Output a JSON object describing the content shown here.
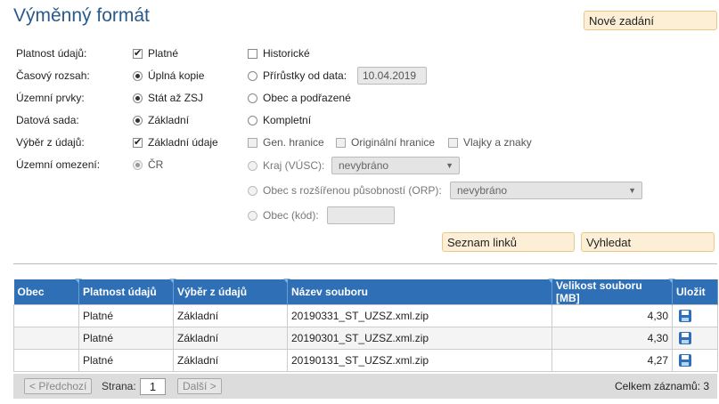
{
  "title": "Výměnný formát",
  "buttons": {
    "new": "Nové zadání",
    "links": "Seznam linků",
    "search": "Vyhledat"
  },
  "form": {
    "validity": {
      "label": "Platnost údajů:",
      "opt1": "Platné",
      "opt2": "Historické"
    },
    "time_range": {
      "label": "Časový rozsah:",
      "opt1": "Úplná kopie",
      "opt2": "Přírůstky od data:",
      "date": "10.04.2019"
    },
    "territorial": {
      "label": "Územní prvky:",
      "opt1": "Stát až ZSJ",
      "opt2": "Obec a podřazené"
    },
    "dataset": {
      "label": "Datová sada:",
      "opt1": "Základní",
      "opt2": "Kompletní"
    },
    "selection": {
      "label": "Výběr z údajů:",
      "opt1": "Základní údaje",
      "opt2": "Gen. hranice",
      "opt3": "Originální hranice",
      "opt4": "Vlajky a znaky"
    },
    "restriction": {
      "label": "Územní omezení:",
      "opt_cr": "ČR",
      "opt_kraj": "Kraj (VÚSC):",
      "kraj_value": "nevybráno",
      "opt_orp": "Obec s rozšířenou působností (ORP):",
      "orp_value": "nevybráno",
      "opt_obec": "Obec (kód):",
      "obec_value": ""
    }
  },
  "table": {
    "columns": [
      "Obec",
      "Platnost údajů",
      "Výběr z údajů",
      "Název souboru",
      "Velikost souboru [MB]",
      "Uložit"
    ],
    "rows": [
      {
        "obec": "",
        "platnost": "Platné",
        "vyber": "Základní",
        "soubor": "20190331_ST_UZSZ.xml.zip",
        "velikost": "4,30"
      },
      {
        "obec": "",
        "platnost": "Platné",
        "vyber": "Základní",
        "soubor": "20190301_ST_UZSZ.xml.zip",
        "velikost": "4,30"
      },
      {
        "obec": "",
        "platnost": "Platné",
        "vyber": "Základní",
        "soubor": "20190131_ST_UZSZ.xml.zip",
        "velikost": "4,27"
      }
    ]
  },
  "pager": {
    "prev": "< Předchozí",
    "page_label": "Strana:",
    "page": "1",
    "next": "Další >",
    "total": "Celkem záznamů: 3"
  }
}
